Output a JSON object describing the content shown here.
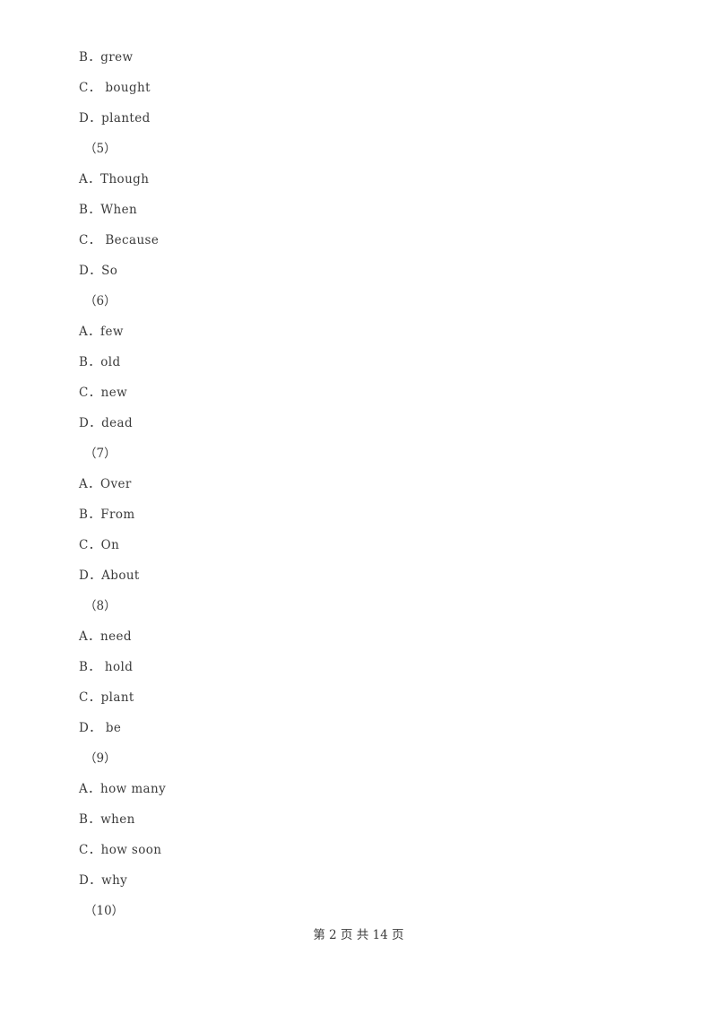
{
  "document": {
    "page_label": "第 2 页 共 14 页",
    "current_page": "2",
    "total_pages": "14",
    "text_color": "#3b3b3b",
    "background_color": "#ffffff",
    "lines": [
      {
        "kind": "option",
        "text": "B．grew"
      },
      {
        "kind": "option",
        "text": "C． bought"
      },
      {
        "kind": "option",
        "text": "D．planted"
      },
      {
        "kind": "qnum",
        "text": "（5）"
      },
      {
        "kind": "option",
        "text": "A．Though"
      },
      {
        "kind": "option",
        "text": "B．When"
      },
      {
        "kind": "option",
        "text": "C． Because"
      },
      {
        "kind": "option",
        "text": "D．So"
      },
      {
        "kind": "qnum",
        "text": "（6）"
      },
      {
        "kind": "option",
        "text": "A．few"
      },
      {
        "kind": "option",
        "text": "B．old"
      },
      {
        "kind": "option",
        "text": "C．new"
      },
      {
        "kind": "option",
        "text": "D．dead"
      },
      {
        "kind": "qnum",
        "text": "（7）"
      },
      {
        "kind": "option",
        "text": "A．Over"
      },
      {
        "kind": "option",
        "text": "B．From"
      },
      {
        "kind": "option",
        "text": "C．On"
      },
      {
        "kind": "option",
        "text": "D．About"
      },
      {
        "kind": "qnum",
        "text": "（8）"
      },
      {
        "kind": "option",
        "text": "A．need"
      },
      {
        "kind": "option",
        "text": "B． hold"
      },
      {
        "kind": "option",
        "text": "C．plant"
      },
      {
        "kind": "option",
        "text": "D． be"
      },
      {
        "kind": "qnum",
        "text": "（9）"
      },
      {
        "kind": "option",
        "text": "A．how many"
      },
      {
        "kind": "option",
        "text": "B．when"
      },
      {
        "kind": "option",
        "text": "C．how soon"
      },
      {
        "kind": "option",
        "text": "D．why"
      },
      {
        "kind": "qnum",
        "text": "（10）"
      }
    ]
  }
}
